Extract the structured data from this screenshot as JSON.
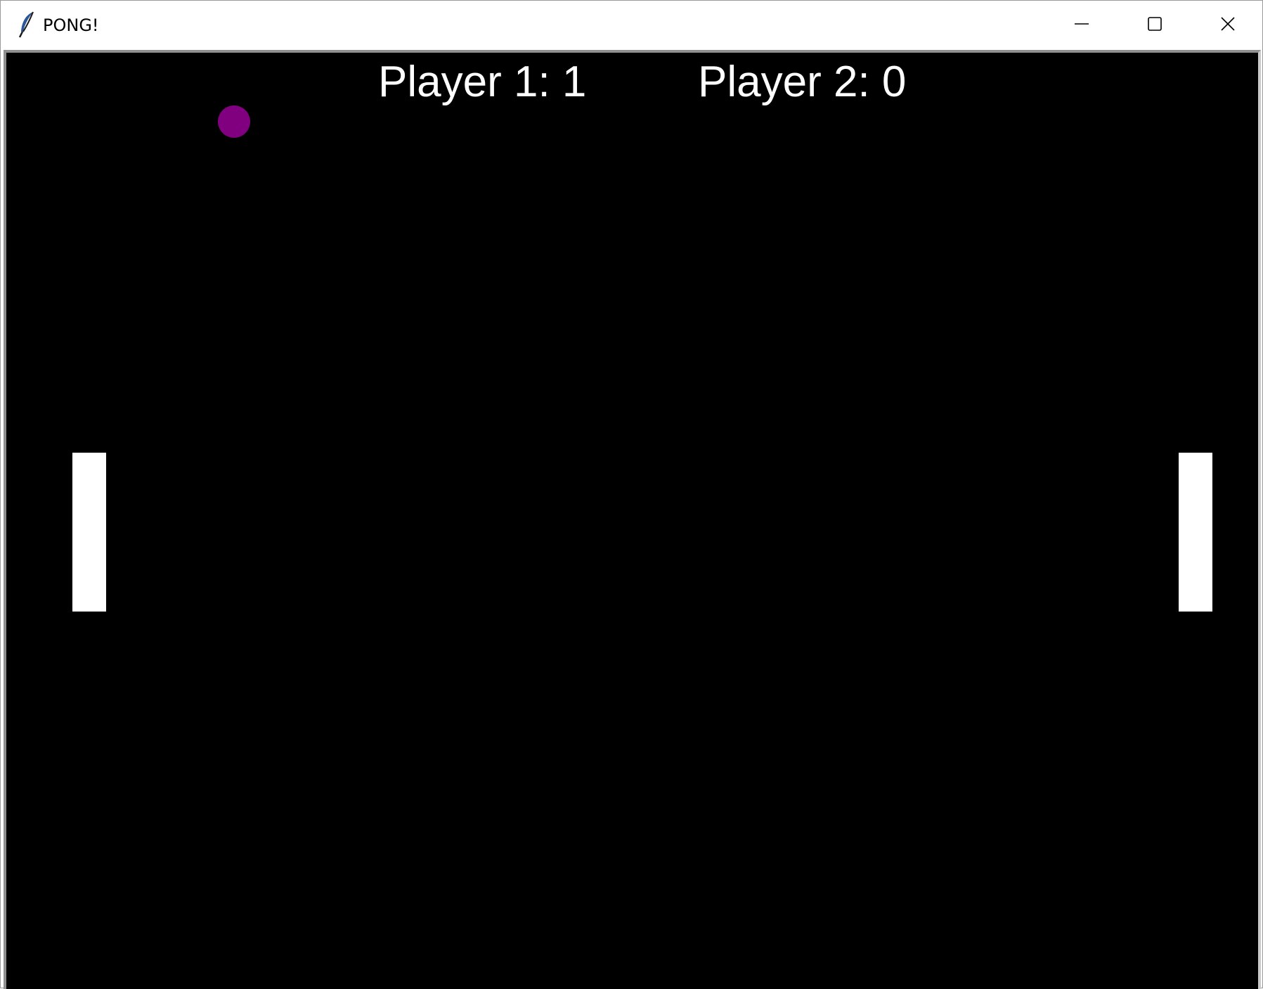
{
  "window": {
    "title": "PONG!",
    "icon": "feather-icon",
    "controls": {
      "minimize": "minimize-icon",
      "maximize": "maximize-icon",
      "close": "close-icon"
    }
  },
  "game": {
    "scoreboard": {
      "player1": "Player 1: 1",
      "player2": "Player 2: 0"
    },
    "colors": {
      "background": "#000000",
      "ball": "#800080",
      "paddles": "#ffffff",
      "text": "#ffffff"
    }
  }
}
